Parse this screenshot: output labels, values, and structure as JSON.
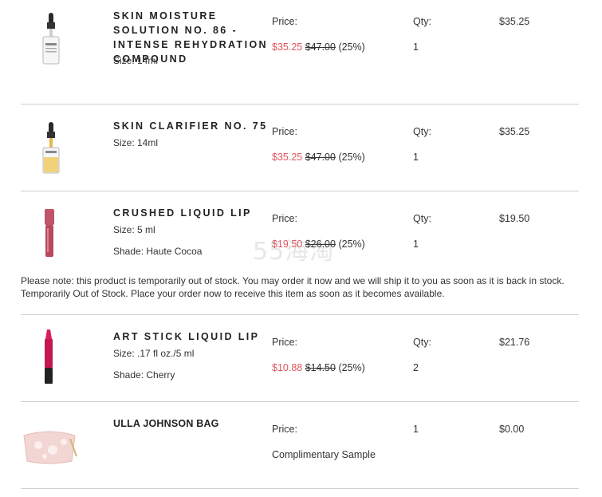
{
  "items": [
    {
      "name": "SKIN MOISTURE SOLUTION NO. 86 - INTENSE REHYDRATION COMPOUND",
      "size": "Size: 14ml",
      "price_label": "Price:",
      "sale_price": "$35.25",
      "orig_price": "$47.00",
      "discount": "(25%)",
      "qty_label": "Qty:",
      "qty": "1",
      "total": "$35.25"
    },
    {
      "name": "SKIN CLARIFIER NO. 75",
      "size": "Size: 14ml",
      "price_label": "Price:",
      "sale_price": "$35.25",
      "orig_price": "$47.00",
      "discount": "(25%)",
      "qty_label": "Qty:",
      "qty": "1",
      "total": "$35.25"
    },
    {
      "name": "CRUSHED LIQUID LIP",
      "size": "Size: 5 ml",
      "shade": "Shade: Haute Cocoa",
      "price_label": "Price:",
      "sale_price": "$19.50",
      "orig_price": "$26.00",
      "discount": "(25%)",
      "qty_label": "Qty:",
      "qty": "1",
      "total": "$19.50",
      "note": "Please note: this product is temporarily out of stock. You may order it now and we will ship it to you as soon as it is back in stock. Temporarily Out of Stock. Place your order now to receive this item as soon as it becomes available."
    },
    {
      "name": "ART STICK LIQUID LIP",
      "size": "Size: .17 fl oz./5 ml",
      "shade": "Shade: Cherry",
      "price_label": "Price:",
      "sale_price": "$10.88",
      "orig_price": "$14.50",
      "discount": "(25%)",
      "qty_label": "Qty:",
      "qty": "2",
      "total": "$21.76"
    },
    {
      "name": "ULLA JOHNSON BAG",
      "price_label": "Price:",
      "complimentary": "Complimentary Sample",
      "qty": "1",
      "total": "$0.00"
    }
  ],
  "watermark": "55海淘",
  "colors": {
    "sale": "#e0555d",
    "divider": "#cfcfcf",
    "text": "#333333"
  }
}
